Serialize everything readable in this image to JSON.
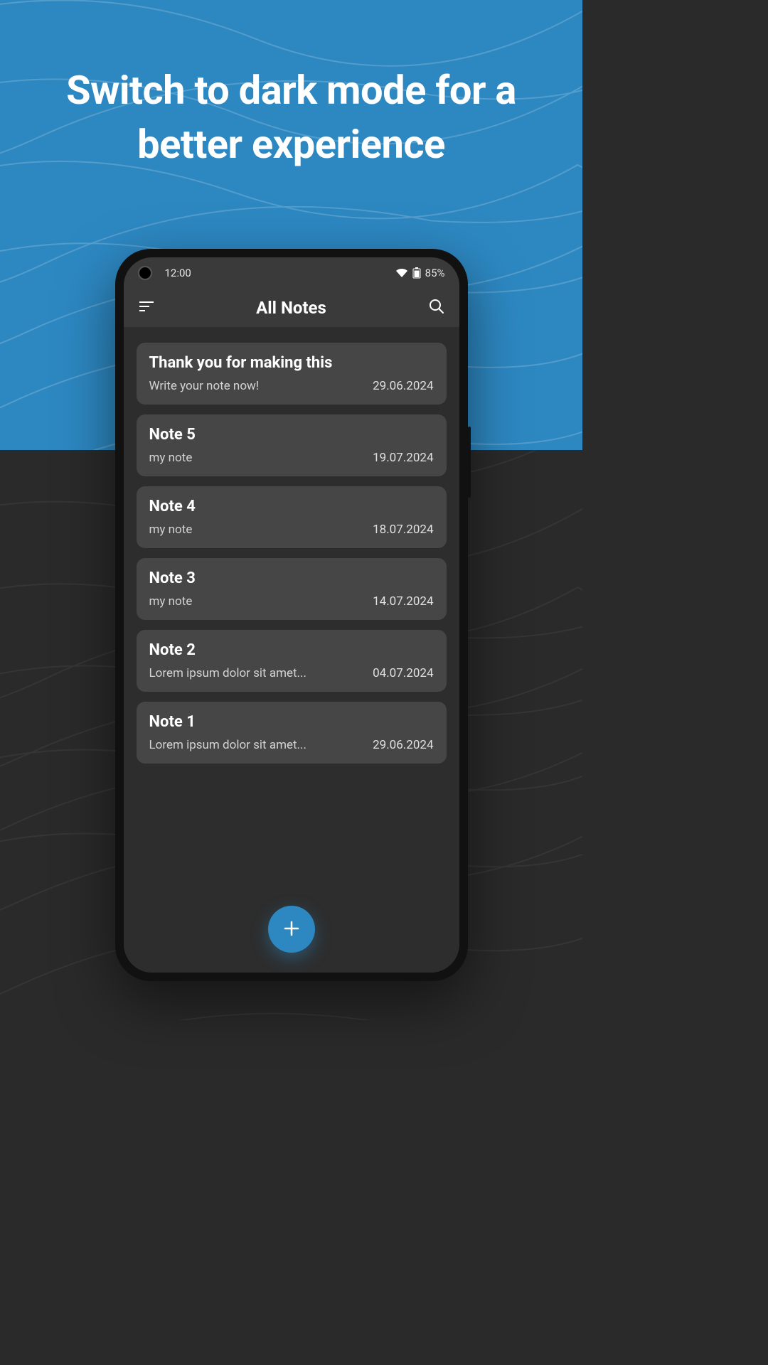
{
  "promo": {
    "headline": "Switch to dark mode for a better experience"
  },
  "status_bar": {
    "time": "12:00",
    "battery_text": "85%"
  },
  "toolbar": {
    "title": "All Notes"
  },
  "notes": [
    {
      "title": "Thank you for making this",
      "snippet": "Write your note now!",
      "date": "29.06.2024"
    },
    {
      "title": "Note 5",
      "snippet": "my note",
      "date": "19.07.2024"
    },
    {
      "title": "Note 4",
      "snippet": "my note",
      "date": "18.07.2024"
    },
    {
      "title": "Note 3",
      "snippet": "my note",
      "date": "14.07.2024"
    },
    {
      "title": "Note 2",
      "snippet": "Lorem ipsum dolor sit amet...",
      "date": "04.07.2024"
    },
    {
      "title": "Note 1",
      "snippet": "Lorem ipsum dolor sit amet...",
      "date": "29.06.2024"
    }
  ],
  "colors": {
    "accent": "#2d88c2",
    "bg_dark": "#2a2a2a",
    "card": "#464646"
  }
}
